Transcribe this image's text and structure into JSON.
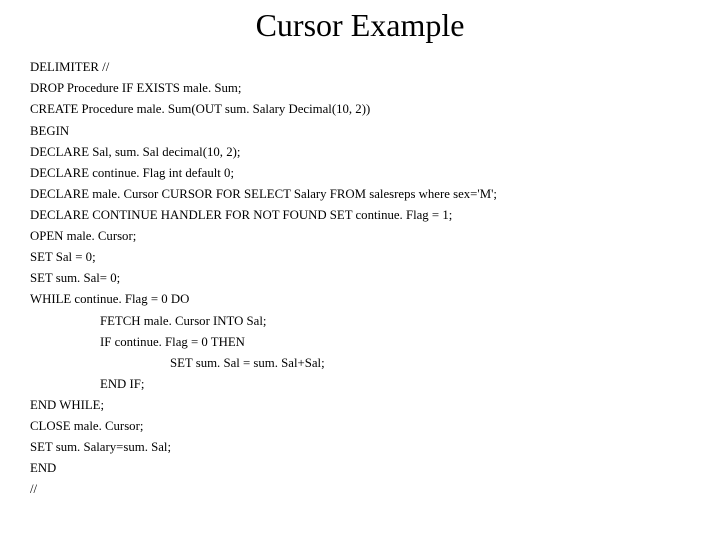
{
  "title": "Cursor Example",
  "code": {
    "l0": "DELIMITER //",
    "l1": "DROP Procedure IF EXISTS male. Sum;",
    "l2": "CREATE Procedure male. Sum(OUT sum. Salary Decimal(10, 2))",
    "l3": "BEGIN",
    "l4": "DECLARE Sal, sum. Sal decimal(10, 2);",
    "l5": "DECLARE continue. Flag int default 0;",
    "l6": "DECLARE male. Cursor CURSOR FOR SELECT Salary FROM salesreps where sex='M';",
    "l7": "DECLARE CONTINUE HANDLER FOR NOT FOUND SET continue. Flag = 1;",
    "l8": "OPEN male. Cursor;",
    "l9": "SET Sal = 0;",
    "l10": "SET sum. Sal= 0;",
    "l11": "WHILE continue. Flag = 0 DO",
    "l12": "FETCH male. Cursor INTO Sal;",
    "l13": "IF continue. Flag = 0 THEN",
    "l14": "SET sum. Sal = sum. Sal+Sal;",
    "l15": "END IF;",
    "l16": "END WHILE;",
    "l17": "CLOSE male. Cursor;",
    "l18": "SET sum. Salary=sum. Sal;",
    "l19": "END",
    "l20": "//"
  }
}
